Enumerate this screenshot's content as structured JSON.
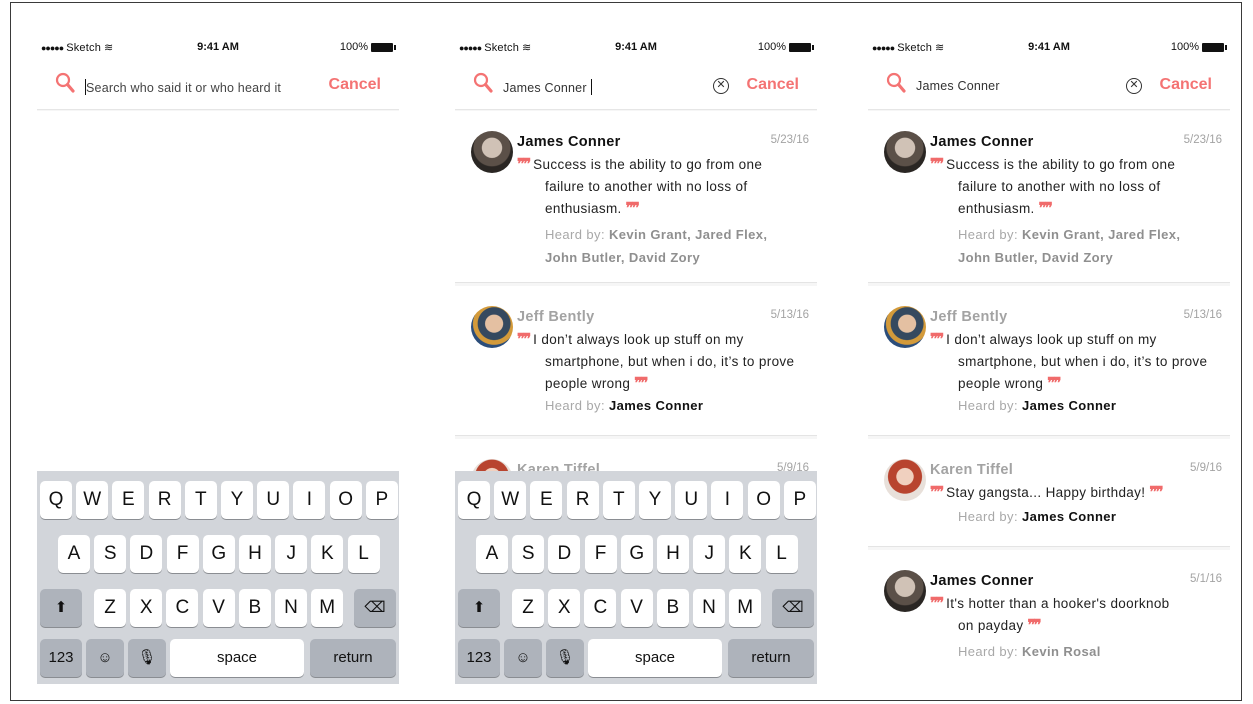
{
  "status": {
    "dots": "●●●●●",
    "carrier": "Sketch",
    "time": "9:41 AM",
    "battery": "100%"
  },
  "screens": [
    {
      "search_placeholder": "Search who said it or who heard it",
      "cancel_label": "Cancel"
    },
    {
      "search_value": "James Conner",
      "cancel_label": "Cancel"
    },
    {
      "search_value": "James Conner",
      "cancel_label": "Cancel"
    }
  ],
  "results": [
    {
      "author": "James Conner",
      "date": "5/23/16",
      "quote_first": "Success is the ability to go from one",
      "quote_rest": "failure to another with no loss of enthusiasm.",
      "heard_label": "Heard by:",
      "heard_names_line1": "Kevin Grant, Jared Flex,",
      "heard_names_line2": "John Butler, David Zory"
    },
    {
      "author": "Jeff Bently",
      "date": "5/13/16",
      "quote_first": "I don’t always look up stuff on my",
      "quote_rest": "smartphone, but when i do, it’s to prove people wrong",
      "heard_label": "Heard by:",
      "heard_names": "James Conner"
    },
    {
      "author": "Karen Tiffel",
      "date": "5/9/16",
      "quote_first": "Stay gangsta... Happy birthday!",
      "heard_label": "Heard by:",
      "heard_names": "James Conner"
    },
    {
      "author": "James Conner",
      "date": "5/1/16",
      "quote_first": "It's hotter than a hooker's doorknob",
      "quote_rest": "on payday",
      "heard_label": "Heard by:",
      "heard_names": "Kevin Rosal"
    }
  ],
  "quote_mark": "❞❞",
  "keyboard": {
    "row1": [
      "Q",
      "W",
      "E",
      "R",
      "T",
      "Y",
      "U",
      "I",
      "O",
      "P"
    ],
    "row2": [
      "A",
      "S",
      "D",
      "F",
      "G",
      "H",
      "J",
      "K",
      "L"
    ],
    "row3": [
      "Z",
      "X",
      "C",
      "V",
      "B",
      "N",
      "M"
    ],
    "shift": "⬆",
    "delete": "⌫",
    "numbers": "123",
    "emoji": "☺",
    "mic": "🎙",
    "space": "space",
    "return": "return"
  },
  "colors": {
    "accent": "#f47373",
    "quote_mark": "#f06b6b",
    "muted_text": "#a3a3a3",
    "keyboard_bg": "#d2d5da",
    "dark_key": "#aeb3bb"
  }
}
